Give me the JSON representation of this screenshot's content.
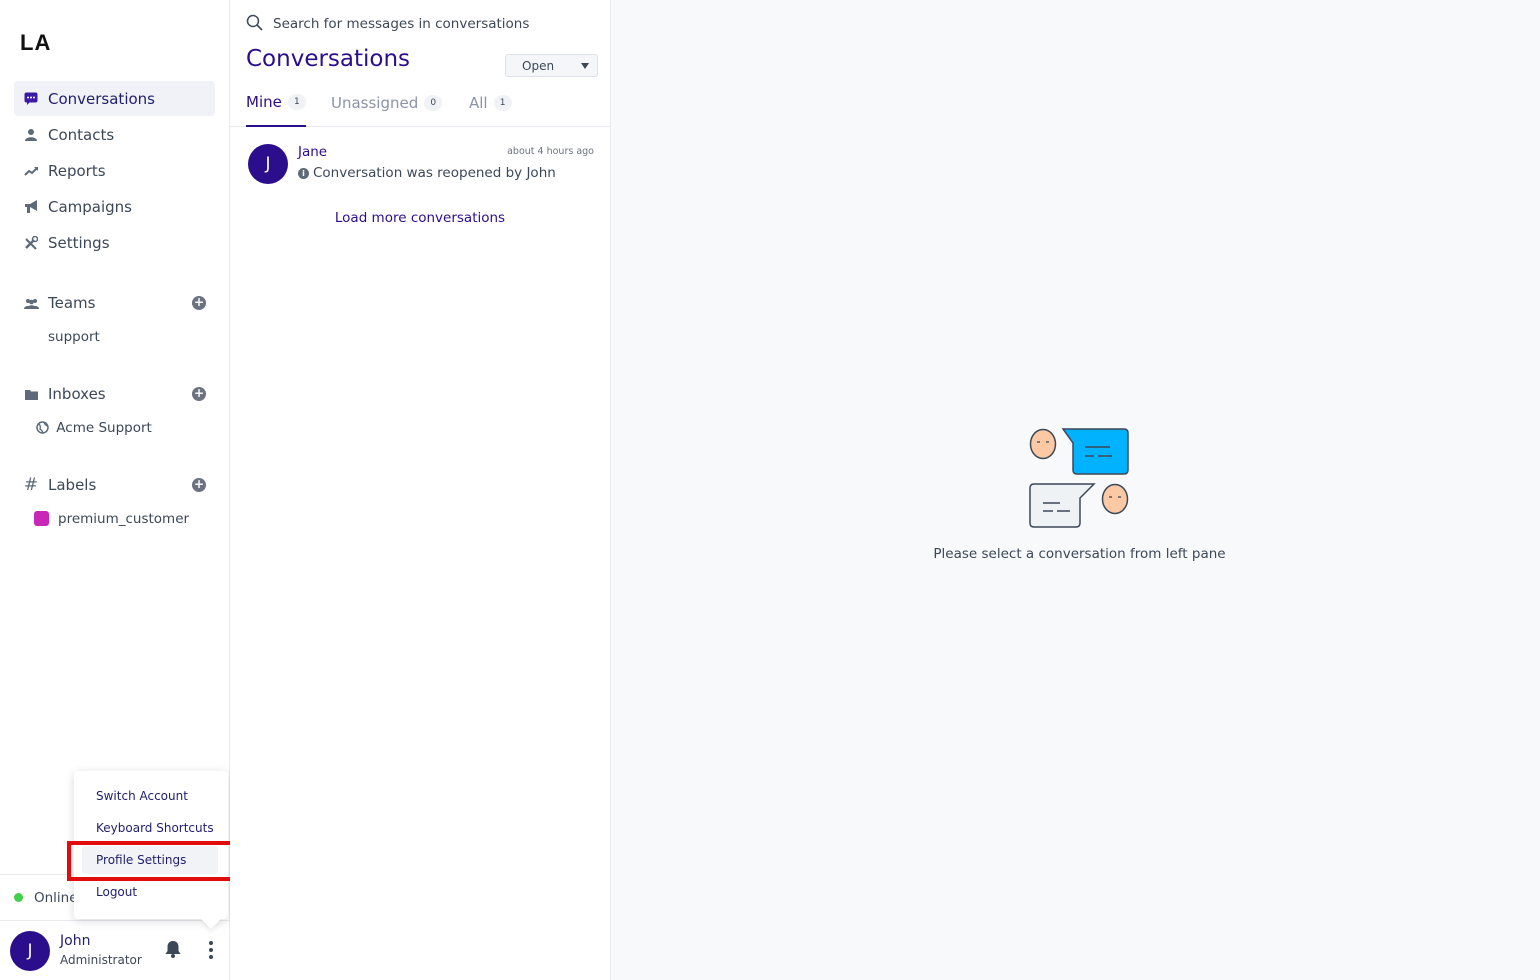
{
  "app": {
    "logo": "LA"
  },
  "sidebar": {
    "nav": [
      {
        "label": "Conversations",
        "icon": "chat-icon",
        "active": true
      },
      {
        "label": "Contacts",
        "icon": "person-icon",
        "active": false
      },
      {
        "label": "Reports",
        "icon": "trend-icon",
        "active": false
      },
      {
        "label": "Campaigns",
        "icon": "megaphone-icon",
        "active": false
      },
      {
        "label": "Settings",
        "icon": "tools-icon",
        "active": false
      }
    ],
    "teams": {
      "label": "Teams",
      "items": [
        "support"
      ]
    },
    "inboxes": {
      "label": "Inboxes",
      "items": [
        "Acme Support"
      ]
    },
    "labels": {
      "label": "Labels",
      "items": [
        {
          "name": "premium_customer",
          "color": "#c728b7"
        }
      ]
    },
    "status": "Online",
    "user": {
      "initial": "J",
      "name": "John",
      "role": "Administrator"
    }
  },
  "menu": {
    "items": [
      "Switch Account",
      "Keyboard Shortcuts",
      "Profile Settings",
      "Logout"
    ],
    "highlighted": "Profile Settings"
  },
  "list": {
    "search_placeholder": "Search for messages in conversations",
    "title": "Conversations",
    "status_filter": "Open",
    "tabs": [
      {
        "label": "Mine",
        "count": "1",
        "active": true
      },
      {
        "label": "Unassigned",
        "count": "0",
        "active": false
      },
      {
        "label": "All",
        "count": "1",
        "active": false
      }
    ],
    "conversations": [
      {
        "initial": "J",
        "name": "Jane",
        "time": "about 4 hours ago",
        "message": "Conversation was reopened by John"
      }
    ],
    "load_more": "Load more conversations"
  },
  "main": {
    "empty_text": "Please select a conversation from left pane"
  },
  "colors": {
    "primary": "#2b0e8c",
    "online": "#44ce4b",
    "highlight": "#e30c0c",
    "bubble": "#00b2ff"
  }
}
